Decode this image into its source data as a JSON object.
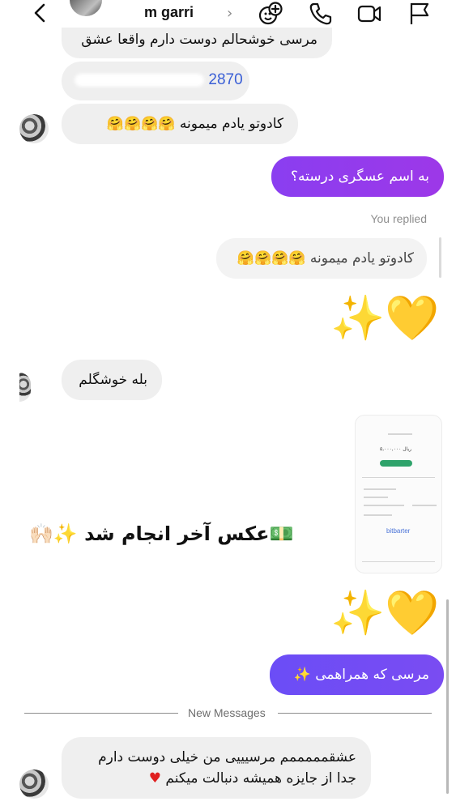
{
  "header": {
    "contact_name": "m        garri",
    "chevron": "›",
    "icons": [
      "back-arrow-icon",
      "add-members-icon",
      "phone-icon",
      "video-call-icon",
      "flag-icon"
    ]
  },
  "messages": {
    "m0_partial": "مرسی خوشحالم دوست دارم واقعا عشق",
    "m1_phone_visible": "2870",
    "m2_text": "کادوتو یادم میمونه 🤗🤗🤗🤗",
    "m3_out": "به اسم عسگری درسته؟",
    "you_replied": "You replied",
    "m4_quoted": "کادوتو یادم میمونه 🤗🤗🤗🤗",
    "m5_emoji": "✨💛",
    "m6_text": "بله خوشگلم",
    "m7_caption": "💵عکس آخر انجام شد ✨🙌🏻",
    "m8_emoji": "✨💛",
    "m9_out": "مرسی که همراهمی ✨",
    "new_messages": "New Messages",
    "m10_line1": "عشقمممممم مرسیییی من خیلی دوست دارم",
    "m10_line2": "جدا از جایزه همیشه دنبالت میکنم"
  },
  "receipt": {
    "amount": "۵,۰۰۰,۰۰۰ ریال",
    "logo": "bitbarter"
  },
  "colors": {
    "incoming_bg": "#efefef",
    "outgoing_gradient_start": "#8a3ef0",
    "outgoing_gradient_end": "#6b4df6",
    "heart": "#e02020"
  }
}
